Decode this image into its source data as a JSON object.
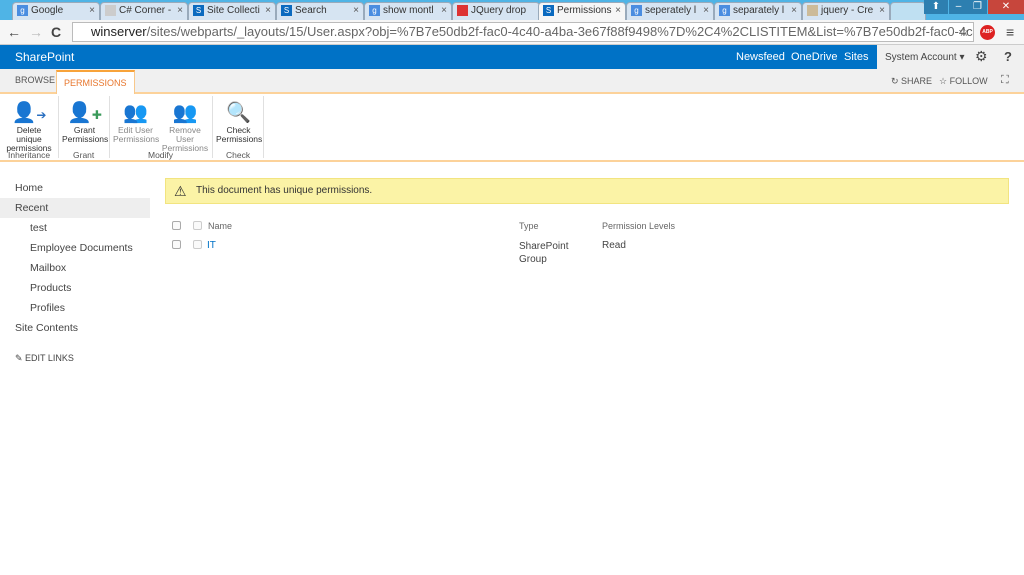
{
  "browser": {
    "tabs": [
      {
        "label": "Google"
      },
      {
        "label": "C# Corner -"
      },
      {
        "label": "Site Collecti"
      },
      {
        "label": "Search"
      },
      {
        "label": "show montl"
      },
      {
        "label": "JQuery drop"
      },
      {
        "label": "Permissions"
      },
      {
        "label": "seperately l"
      },
      {
        "label": "separately l"
      },
      {
        "label": "jquery - Cre"
      }
    ],
    "url_host": "winserver",
    "url_path": "/sites/webparts/_layouts/15/User.aspx?obj=%7B7e50db2f-fac0-4c40-a4ba-3e67f88f9498%7D%2C4%2CLISTITEM&List=%7B7e50db2f-fac0-4c40-a4ba-3e6",
    "abp": "ABP"
  },
  "suite": {
    "brand": "SharePoint",
    "links": [
      "Newsfeed",
      "OneDrive",
      "Sites"
    ],
    "account": "System Account ▾"
  },
  "ribbon": {
    "tabs": [
      "BROWSE",
      "PERMISSIONS"
    ],
    "share": "SHARE",
    "follow": "FOLLOW",
    "buttons": [
      {
        "l1": "Delete unique",
        "l2": "permissions"
      },
      {
        "l1": "Grant",
        "l2": "Permissions"
      },
      {
        "l1": "Edit User",
        "l2": "Permissions"
      },
      {
        "l1": "Remove User",
        "l2": "Permissions"
      },
      {
        "l1": "Check",
        "l2": "Permissions"
      }
    ],
    "groups": [
      "Inheritance",
      "Grant",
      "Modify",
      "Check"
    ]
  },
  "nav": {
    "items": [
      "Home",
      "Recent",
      "test",
      "Employee Documents",
      "Mailbox",
      "Products",
      "Profiles",
      "Site Contents"
    ],
    "edit_links": "EDIT LINKS"
  },
  "main": {
    "notice": "This document has unique permissions.",
    "columns": [
      "Name",
      "Type",
      "Permission Levels"
    ],
    "rows": [
      {
        "name": "IT",
        "type1": "SharePoint",
        "type2": "Group",
        "level": "Read"
      }
    ]
  }
}
